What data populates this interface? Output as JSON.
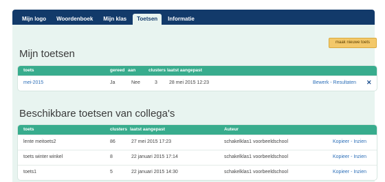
{
  "nav": {
    "tabs": [
      {
        "label": "Mijn logo"
      },
      {
        "label": "Woordenboek"
      },
      {
        "label": "Mijn klas"
      },
      {
        "label": "Toetsen"
      },
      {
        "label": "Informatie"
      }
    ],
    "active_tab": "Toetsen"
  },
  "actions": {
    "new_test_label": "maak nieuwe toets"
  },
  "my_tests": {
    "title": "Mijn toetsen",
    "headers": {
      "toets": "toets",
      "gereed": "gereed",
      "aan": "aan",
      "clusters": "clusters",
      "laatst": "laatst aangepast"
    },
    "rows": [
      {
        "toets": "mei-2015",
        "gereed": "Ja",
        "aan": "Nee",
        "clusters": "3",
        "laatst": "28 mei 2015 12:23",
        "action": "Bewerk - Resultaten",
        "close": "✕"
      }
    ]
  },
  "colleague_tests": {
    "title": "Beschikbare toetsen van collega's",
    "headers": {
      "toets": "toets",
      "clusters": "clusters",
      "laatst": "laatst aangepast",
      "auteur": "Auteur"
    },
    "rows": [
      {
        "toets": "lente meitoets2",
        "clusters": "86",
        "laatst": "27 mei 2015 17:23",
        "auteur": "schakelklas1 voorbeeldschool",
        "action": "Kopieer - Inzien"
      },
      {
        "toets": "toets winter winkel",
        "clusters": "8",
        "laatst": "22 januari 2015 17:14",
        "auteur": "schakelklas1 voorbeeldschool",
        "action": "Kopieer - Inzien"
      },
      {
        "toets": "toets1",
        "clusters": "5",
        "laatst": "22 januari 2015 14:30",
        "auteur": "schakelklas1 voorbeeldschool",
        "action": "Kopieer - Inzien"
      }
    ]
  }
}
